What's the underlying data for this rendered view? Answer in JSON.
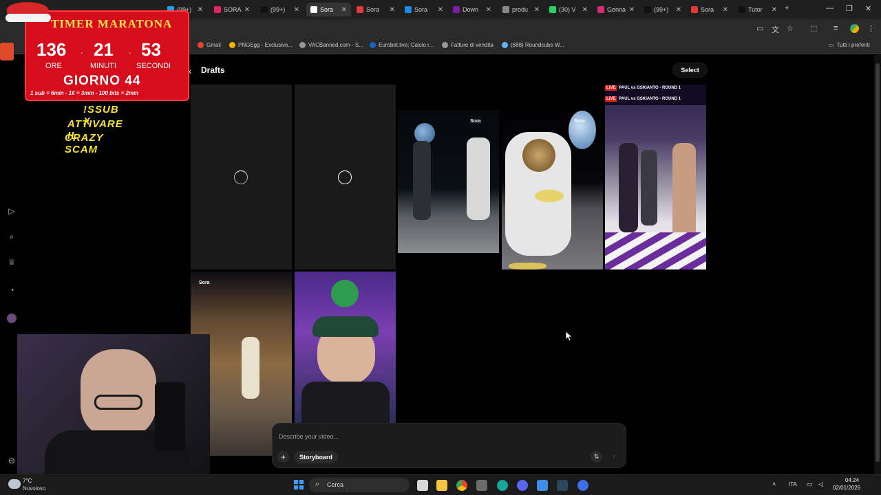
{
  "browser": {
    "tabs": [
      {
        "label": "(99+)",
        "active": false,
        "color": "#1da1f2"
      },
      {
        "label": "SORA",
        "active": false,
        "color": "#e0245e"
      },
      {
        "label": "(99+)",
        "active": false,
        "color": "#111111"
      },
      {
        "label": "Sora",
        "active": true,
        "color": "#ffffff"
      },
      {
        "label": "Sora",
        "active": false,
        "color": "#e53935"
      },
      {
        "label": "Sora",
        "active": false,
        "color": "#1e88e5"
      },
      {
        "label": "Down",
        "active": false,
        "color": "#7b1fa2"
      },
      {
        "label": "produ",
        "active": false,
        "color": "#888888"
      },
      {
        "label": "(30) V",
        "active": false,
        "color": "#25d366"
      },
      {
        "label": "Genna",
        "active": false,
        "color": "#d62976"
      },
      {
        "label": "(99+)",
        "active": false,
        "color": "#111111"
      },
      {
        "label": "Sora",
        "active": false,
        "color": "#e53935"
      },
      {
        "label": "Tutor",
        "active": false,
        "color": "#111111"
      }
    ],
    "bookmarks": [
      {
        "label": "Gmail",
        "color": "#ea4335"
      },
      {
        "label": "PNGEgg - Exclusive...",
        "color": "#f4b400"
      },
      {
        "label": "VACBanned.com - S...",
        "color": "#999999"
      },
      {
        "label": "Eurobet.live: Calcio r...",
        "color": "#1565c0"
      },
      {
        "label": "Fatture di vendita",
        "color": "#999999"
      },
      {
        "label": "(688) Roundcube W...",
        "color": "#64b5f6"
      }
    ],
    "all_bookmarks_label": "Tutti i preferiti"
  },
  "page": {
    "back_icon": "chevron-left-icon",
    "title": "Drafts",
    "select_label": "Select",
    "tiles": [
      {
        "kind": "loading"
      },
      {
        "kind": "loading"
      },
      {
        "kind": "video",
        "subject": "astronauts on moon",
        "watermark": "Sora"
      },
      {
        "kind": "video",
        "subject": "astronaut sitting on moon",
        "watermark": "Sora"
      },
      {
        "kind": "video",
        "subject": "boxing match",
        "overlay_tag": "LIVE",
        "overlay_text": "PAUL vs GSKIANTO - ROUND 1"
      },
      {
        "kind": "video",
        "subject": "man in plaza at night",
        "watermark": "Sora"
      },
      {
        "kind": "video",
        "subject": "streamer smiling"
      }
    ],
    "prompt": {
      "placeholder": "Describe your video...",
      "storyboard_label": "Storyboard"
    }
  },
  "overlay": {
    "timer_title": "TIMER MARATONA",
    "hours": "136",
    "hours_label": "ORE",
    "minutes": "21",
    "minutes_label": "MINUTI",
    "seconds": "53",
    "seconds_label": "SECONDI",
    "day_label": "GIORNO 44",
    "rates": "1 sub = 6min - 1€ = 3min - 100 bits = 2min",
    "promo_line1": "!SSUB X",
    "promo_line2": "ATTIVARE IL",
    "promo_line3": "CRAZY SCAM"
  },
  "taskbar": {
    "weather_temp": "7°C",
    "weather_condition": "Nuvoloso",
    "search_label": "Cerca",
    "language": "ITA",
    "time": "04:24",
    "date": "02/01/2026"
  }
}
